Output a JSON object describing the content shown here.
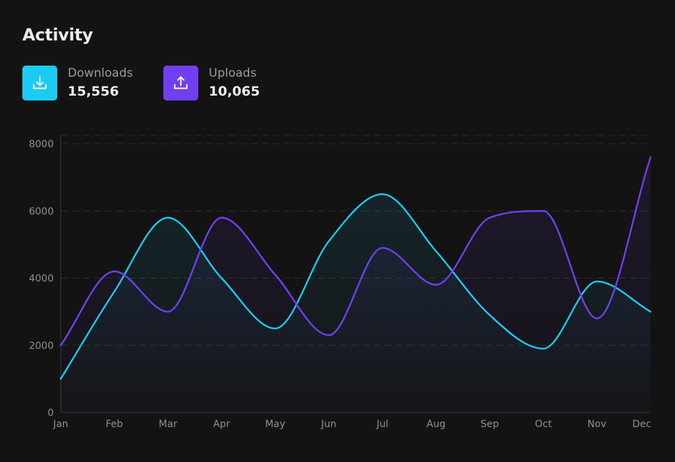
{
  "header": {
    "title": "Activity"
  },
  "stats": {
    "downloads": {
      "label": "Downloads",
      "value": "15,556",
      "icon": "download-icon",
      "color": "#1ccbf3"
    },
    "uploads": {
      "label": "Uploads",
      "value": "10,065",
      "icon": "upload-icon",
      "color": "#7040f0"
    }
  },
  "chart_data": {
    "type": "area",
    "categories": [
      "Jan",
      "Feb",
      "Mar",
      "Apr",
      "May",
      "Jun",
      "Jul",
      "Aug",
      "Sep",
      "Oct",
      "Nov",
      "Dec"
    ],
    "series": [
      {
        "name": "Downloads",
        "color": "#1ccbf3",
        "values": [
          1000,
          3600,
          5800,
          4000,
          2500,
          5100,
          6500,
          4800,
          2900,
          1900,
          3900,
          3000
        ]
      },
      {
        "name": "Uploads",
        "color": "#7040f0",
        "values": [
          2000,
          4200,
          3000,
          5800,
          4100,
          2300,
          4900,
          3800,
          5800,
          6000,
          2800,
          7600
        ]
      }
    ],
    "ylim": [
      0,
      8000
    ],
    "yticks": [
      "0",
      "2000",
      "4000",
      "6000",
      "8000"
    ],
    "grid": true,
    "grid_style": "dashed-horizontal",
    "title": "",
    "xlabel": "",
    "ylabel": ""
  }
}
